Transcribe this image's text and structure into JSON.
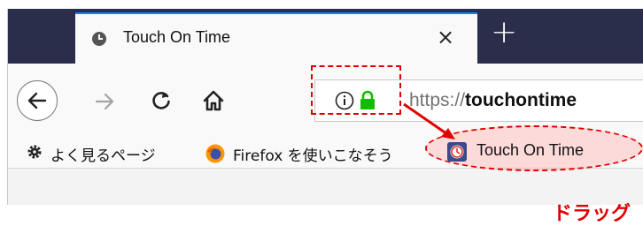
{
  "tab": {
    "title": "Touch On Time",
    "close_label": "×",
    "new_tab_label": "+"
  },
  "toolbar": {
    "back_icon": "back-arrow-icon",
    "forward_icon": "forward-arrow-icon",
    "reload_icon": "reload-icon",
    "home_icon": "home-icon"
  },
  "urlbar": {
    "info_icon": "info-icon",
    "lock_icon": "lock-icon",
    "url_scheme": "https://",
    "url_host": "touchontime"
  },
  "bookmarks": [
    {
      "label": "よく見るページ",
      "icon": "gear-icon"
    },
    {
      "label": "Firefox を使いこなそう",
      "icon": "firefox-icon"
    },
    {
      "label": "Touch On Time",
      "icon": "touch-on-time-icon"
    }
  ],
  "annotation": {
    "caption": "ドラッグ",
    "color": "#e00000"
  },
  "colors": {
    "tabstrip": "#2a2e4b",
    "accent": "#0a84ff",
    "lock": "#12bc00"
  }
}
